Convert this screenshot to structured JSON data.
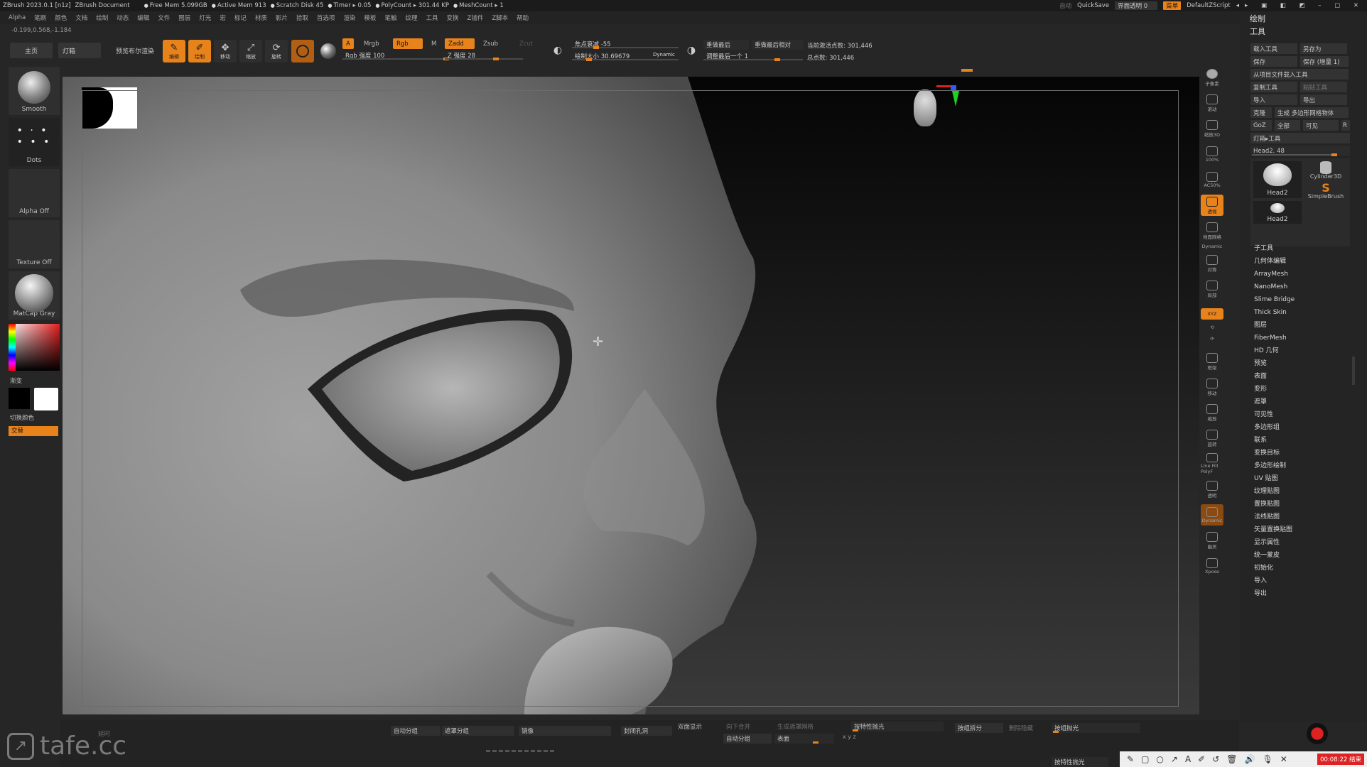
{
  "titlebar": {
    "app": "ZBrush 2023.0.1 [n1z]",
    "document": "ZBrush Document",
    "stats": [
      "Free Mem 5.099GB",
      "Active Mem 913",
      "Scratch Disk 45",
      "Timer ▸ 0.05",
      "PolyCount ▸ 301.44 KP",
      "MeshCount ▸ 1"
    ],
    "auto": "自动",
    "quicksave": "QuickSave",
    "transparency": "界面透明 0",
    "menus_chip": "菜单",
    "script": "DefaultZScript"
  },
  "menubar": [
    "Alpha",
    "笔刷",
    "颜色",
    "文档",
    "绘制",
    "动态",
    "编辑",
    "文件",
    "图层",
    "灯光",
    "宏",
    "标记",
    "材质",
    "影片",
    "拾取",
    "首选项",
    "渲染",
    "模板",
    "笔触",
    "纹理",
    "工具",
    "变换",
    "Z插件",
    "Z脚本",
    "帮助"
  ],
  "coords": "-0.199,0.568,-1.184",
  "toolrow": {
    "home": "主页",
    "lightbox": "灯箱",
    "bpr": "预览布尔渲染",
    "edit": "编辑",
    "draw": "绘制",
    "move": "移动",
    "scale": "缩放",
    "rotate": "旋转",
    "a_chip": "A",
    "mrgb": "Mrgb",
    "rgb": "Rgb",
    "m": "M",
    "rgb_intensity": "Rgb 强度 100",
    "zadd": "Zadd",
    "zsub": "Zsub",
    "zcut": "Zcut",
    "z_intensity": "Z 强度 28",
    "focal": "焦点衰减 -55",
    "draw_size": "绘制大小 30.69679",
    "dynamic": "Dynamic",
    "replay_last": "重做最后",
    "replay_rel": "重做最后相对",
    "adjust_last": "调整最后一个 1",
    "active_points": "当前激活点数: 301,446",
    "total_points": "总点数: 301,446"
  },
  "leftshelf": {
    "brush": "Smooth",
    "stroke": "Dots",
    "alpha": "Alpha Off",
    "texture": "Texture Off",
    "material": "MatCap Gray",
    "gradient": "渐变",
    "switch_color": "切换颜色",
    "alternate": "交替"
  },
  "rightcol": [
    "子像素",
    "滚动",
    "缩放3D",
    "100%",
    "AC50%",
    "透视",
    "地面网格",
    "Dynamic",
    "对称",
    "局部",
    "XYZ",
    "",
    "",
    "框架",
    "移动",
    "缩放",
    "旋转",
    "Line Fill PolyF",
    "透明",
    "Dynamic",
    "幽灵",
    "Xpose"
  ],
  "rightpanel": {
    "draw": "绘制",
    "tool": "工具",
    "load_tool": "载入工具",
    "save_as": "另存为",
    "save": "保存",
    "save_inc": "保存 (增量 1)",
    "load_project": "从项目文件载入工具",
    "copy_tool": "复制工具",
    "paste_tool": "粘贴工具",
    "import": "导入",
    "export": "导出",
    "clone": "克隆",
    "make_polymesh": "生成 多边形网格物体",
    "goz": "GoZ",
    "all": "全部",
    "visible": "可见",
    "r": "R",
    "lightbox_tools": "灯箱▸工具",
    "head_slider": "Head2. 48",
    "tool_head": "Head2",
    "tool_cyl": "Cylinder3D",
    "tool_simple": "SimpleBrush",
    "tool_head_small": "Head2",
    "list": [
      "子工具",
      "几何体编辑",
      "ArrayMesh",
      "NanoMesh",
      "Slime Bridge",
      "Thick Skin",
      "图层",
      "FiberMesh",
      "HD 几何",
      "预览",
      "表面",
      "变形",
      "遮罩",
      "可见性",
      "多边形组",
      "联系",
      "变换目标",
      "多边形绘制",
      "UV 贴图",
      "纹理贴图",
      "置换贴图",
      "法线贴图",
      "矢量置换贴图",
      "显示属性",
      "统一蒙皮",
      "初始化",
      "导入",
      "导出"
    ]
  },
  "bottombar": {
    "b0": "延时",
    "auto_group": "自动分组",
    "mask_group": "遮罩分组",
    "mirror": "镜像",
    "close_holes": "封闭孔洞",
    "double": "双面显示",
    "merge_down": "向下合并",
    "gen_mask": "生成遮罩网格",
    "auto_group2": "自动分组",
    "surface": "表面",
    "polish_feature": "按特性抛光",
    "polish_group": "按组拆分",
    "del_hidden": "删除隐藏",
    "polish_groups": "按组抛光",
    "polish_feature2": "按特性抛光",
    "xyz": "x y z"
  },
  "watermark": "tafe.cc",
  "timer": "00:08:22 结束"
}
